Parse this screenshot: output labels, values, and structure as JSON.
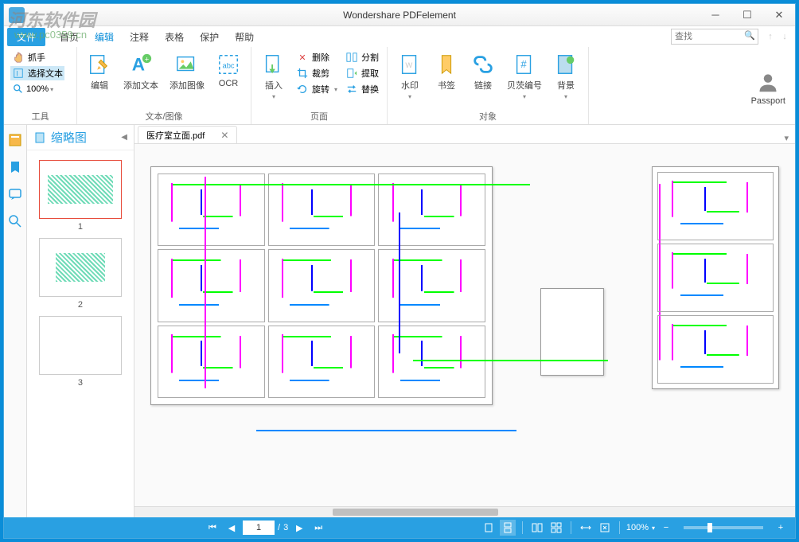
{
  "app_title": "Wondershare PDFelement",
  "watermark": {
    "site_name": "河东软件园",
    "url": "www.pc0359.cn"
  },
  "menu": {
    "file_tab": "文件",
    "items": [
      "首页",
      "编辑",
      "注释",
      "表格",
      "保护",
      "帮助"
    ],
    "active_index": 1
  },
  "search": {
    "placeholder": "查找"
  },
  "ribbon": {
    "tools_group": {
      "label": "工具",
      "hand": "抓手",
      "select_text": "选择文本",
      "zoom": "100%"
    },
    "text_image_group": {
      "label": "文本/图像",
      "edit": "编辑",
      "add_text": "添加文本",
      "add_image": "添加图像",
      "ocr": "OCR"
    },
    "page_group": {
      "label": "页面",
      "insert": "插入",
      "delete": "删除",
      "crop": "裁剪",
      "rotate": "旋转",
      "split": "分割",
      "extract": "提取",
      "replace": "替换"
    },
    "object_group": {
      "label": "对象",
      "watermark": "水印",
      "bookmark": "书签",
      "link": "链接",
      "bates": "贝茨编号",
      "background": "背景"
    },
    "passport": "Passport"
  },
  "thumbnails": {
    "title": "缩略图",
    "pages": [
      "1",
      "2",
      "3"
    ],
    "selected": 0
  },
  "document": {
    "tab_name": "医疗室立面.pdf",
    "current_page": "1",
    "total_pages": "3",
    "page_sep": "/"
  },
  "status": {
    "zoom": "100%"
  }
}
